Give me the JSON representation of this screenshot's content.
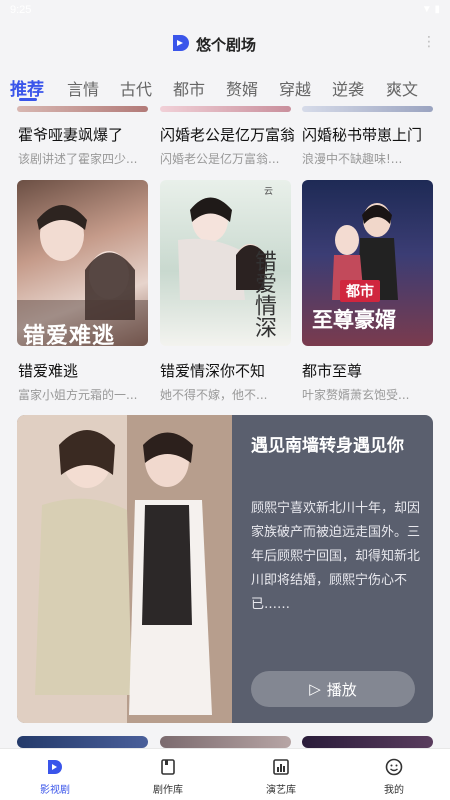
{
  "status": {
    "time": "9:25",
    "icons": "▼ ▮"
  },
  "app": {
    "title": "悠个剧场",
    "more": "⋮"
  },
  "tabs": [
    "推荐",
    "言情",
    "古代",
    "都市",
    "赘婿",
    "穿越",
    "逆袭",
    "爽文"
  ],
  "row1": [
    {
      "title": "霍爷哑妻飒爆了",
      "desc": "该剧讲述了霍家四少..."
    },
    {
      "title": "闪婚老公是亿万富翁",
      "desc": "闪婚老公是亿万富翁..."
    },
    {
      "title": "闪婚秘书带崽上门",
      "desc": "浪漫中不缺趣味!..."
    }
  ],
  "row2": [
    {
      "title": "错爱难逃",
      "desc": "富家小姐方元霜的一...",
      "poster_text": "错爱难逃"
    },
    {
      "title": "错爱情深你不知",
      "desc": "她不得不嫁，他不...",
      "poster_text": "错爱情深",
      "poster_small": "云"
    },
    {
      "title": "都市至尊",
      "desc": "叶家赘婿萧玄饱受...",
      "poster_tag": "都市",
      "poster_text": "至尊豪婿"
    }
  ],
  "feature": {
    "title": "遇见南墙转身遇见你",
    "desc": "顾熙宁喜欢新北川十年，却因家族破产而被迫远走国外。三年后顾熙宁回国，却得知新北川即将结婚，顾熙宁伤心不已……",
    "play_label": "播放",
    "play_icon": "▷"
  },
  "bottom_nav": [
    {
      "label": "影视剧",
      "icon": "video-logo-icon"
    },
    {
      "label": "剧作库",
      "icon": "book-icon"
    },
    {
      "label": "演艺库",
      "icon": "chart-icon"
    },
    {
      "label": "我的",
      "icon": "smile-icon"
    }
  ],
  "colors": {
    "accent": "#3a55ea",
    "card_bg": "#5a5f6e"
  }
}
